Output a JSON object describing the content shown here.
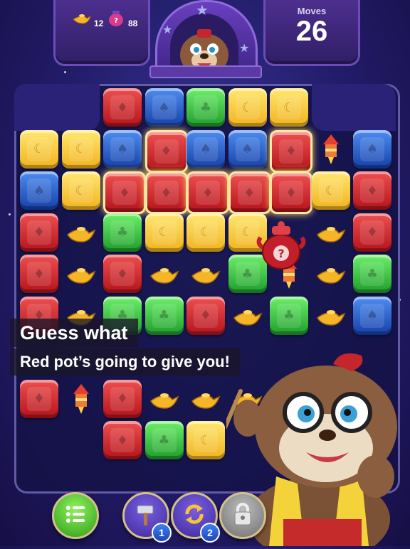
{
  "hud": {
    "goals": [
      {
        "icon": "magic-lamp-icon",
        "count": "12"
      },
      {
        "icon": "mystery-pot-icon",
        "count": "88"
      }
    ],
    "moves_label": "Moves",
    "moves_value": "26"
  },
  "caption": {
    "line1": "Guess what",
    "line2": "Red pot’s going to give you!"
  },
  "board": {
    "tiles": [
      {
        "color": "red",
        "c": 2,
        "r": 0
      },
      {
        "color": "blue",
        "c": 3,
        "r": 0
      },
      {
        "color": "green",
        "c": 4,
        "r": 0
      },
      {
        "color": "yellow",
        "c": 5,
        "r": 0
      },
      {
        "color": "yellow",
        "c": 6,
        "r": 0
      },
      {
        "color": "yellow",
        "c": 0,
        "r": 1
      },
      {
        "color": "yellow",
        "c": 1,
        "r": 1
      },
      {
        "color": "blue",
        "c": 2,
        "r": 1
      },
      {
        "color": "red",
        "c": 3,
        "r": 1,
        "bubble": true
      },
      {
        "color": "blue",
        "c": 4,
        "r": 1
      },
      {
        "color": "blue",
        "c": 5,
        "r": 1
      },
      {
        "color": "red",
        "c": 6,
        "r": 1,
        "bubble": true
      },
      {
        "color": "blue",
        "c": 8,
        "r": 1
      },
      {
        "color": "blue",
        "c": 0,
        "r": 2
      },
      {
        "color": "yellow",
        "c": 1,
        "r": 2
      },
      {
        "color": "red",
        "c": 2,
        "r": 2,
        "bubble": true
      },
      {
        "color": "red",
        "c": 3,
        "r": 2,
        "bubble": true
      },
      {
        "color": "red",
        "c": 4,
        "r": 2,
        "bubble": true
      },
      {
        "color": "red",
        "c": 5,
        "r": 2,
        "bubble": true
      },
      {
        "color": "red",
        "c": 6,
        "r": 2,
        "bubble": true
      },
      {
        "color": "yellow",
        "c": 7,
        "r": 2
      },
      {
        "color": "red",
        "c": 8,
        "r": 2
      },
      {
        "color": "red",
        "c": 0,
        "r": 3
      },
      {
        "color": "green",
        "c": 2,
        "r": 3
      },
      {
        "color": "yellow",
        "c": 3,
        "r": 3
      },
      {
        "color": "yellow",
        "c": 4,
        "r": 3
      },
      {
        "color": "yellow",
        "c": 5,
        "r": 3
      },
      {
        "color": "red",
        "c": 8,
        "r": 3
      },
      {
        "color": "red",
        "c": 0,
        "r": 4
      },
      {
        "color": "red",
        "c": 2,
        "r": 4
      },
      {
        "color": "green",
        "c": 5,
        "r": 4
      },
      {
        "color": "green",
        "c": 8,
        "r": 4
      },
      {
        "color": "red",
        "c": 0,
        "r": 5
      },
      {
        "color": "green",
        "c": 2,
        "r": 5
      },
      {
        "color": "green",
        "c": 3,
        "r": 5
      },
      {
        "color": "red",
        "c": 4,
        "r": 5
      },
      {
        "color": "green",
        "c": 6,
        "r": 5
      },
      {
        "color": "blue",
        "c": 8,
        "r": 5
      },
      {
        "color": "red",
        "c": 0,
        "r": 7
      },
      {
        "color": "red",
        "c": 2,
        "r": 7
      },
      {
        "color": "red",
        "c": 2,
        "r": 8
      },
      {
        "color": "green",
        "c": 3,
        "r": 8
      },
      {
        "color": "yellow",
        "c": 4,
        "r": 8
      }
    ],
    "lamps": [
      {
        "c": 1,
        "r": 3
      },
      {
        "c": 7,
        "r": 3
      },
      {
        "c": 1,
        "r": 4
      },
      {
        "c": 3,
        "r": 4
      },
      {
        "c": 4,
        "r": 4
      },
      {
        "c": 7,
        "r": 4
      },
      {
        "c": 1,
        "r": 5
      },
      {
        "c": 5,
        "r": 5
      },
      {
        "c": 7,
        "r": 5
      },
      {
        "c": 3,
        "r": 7
      },
      {
        "c": 4,
        "r": 7
      },
      {
        "c": 5,
        "r": 7
      }
    ],
    "rockets": [
      {
        "c": 7,
        "r": 1
      },
      {
        "c": 1,
        "r": 7
      },
      {
        "c": 6,
        "r": 4
      }
    ]
  },
  "boosters": [
    {
      "name": "menu-button",
      "icon": "menu-list-icon",
      "count": ""
    },
    {
      "name": "hammer-booster-button",
      "icon": "hammer-icon",
      "count": "1"
    },
    {
      "name": "shuffle-booster-button",
      "icon": "shuffle-icon",
      "count": "2"
    },
    {
      "name": "locked-booster-button",
      "icon": "padlock-icon",
      "count": ""
    }
  ]
}
